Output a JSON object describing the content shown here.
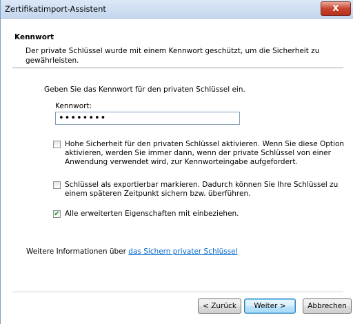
{
  "window": {
    "title": "Zertifikatimport-Assistent",
    "close_label": "X"
  },
  "header": {
    "title": "Kennwort",
    "description": "Der private Schlüssel wurde mit einem Kennwort geschützt, um die Sicherheit zu gewährleisten."
  },
  "body": {
    "prompt": "Geben Sie das Kennwort für den privaten Schlüssel ein.",
    "password_label": "Kennwort:",
    "password_value": "••••••••",
    "options": [
      {
        "checked": false,
        "label": "Hohe Sicherheit für den privaten Schlüssel aktivieren. Wenn Sie diese Option aktivieren, werden Sie immer dann, wenn der private Schlüssel von einer Anwendung verwendet wird, zur Kennworteingabe aufgefordert."
      },
      {
        "checked": false,
        "label": "Schlüssel als exportierbar markieren. Dadurch können Sie Ihre Schlüssel zu einem späteren Zeitpunkt sichern bzw. überführen."
      },
      {
        "checked": true,
        "label": "Alle erweiterten Eigenschaften mit einbeziehen."
      }
    ],
    "more_info_prefix": "Weitere Informationen über ",
    "more_info_link": "das Sichern privater Schlüssel"
  },
  "footer": {
    "back_label": "< Zurück",
    "next_label": "Weiter >",
    "cancel_label": "Abbrechen"
  },
  "colors": {
    "link": "#0066cc",
    "checkmark": "#21a121",
    "close_button": "#c9452f"
  }
}
